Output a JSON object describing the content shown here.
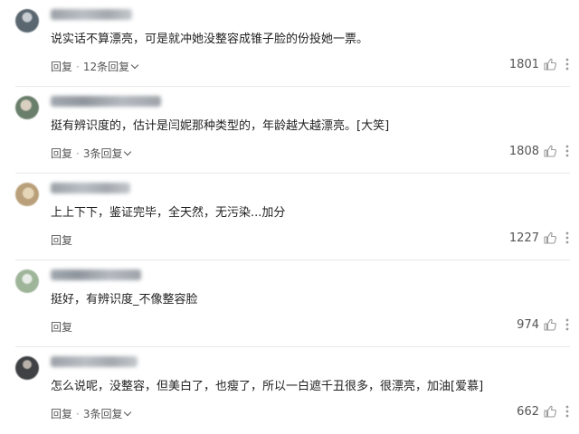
{
  "comments": [
    {
      "text": "说实话不算漂亮，可是就冲她没整容成锥子脸的份投她一票。",
      "reply_label": "回复",
      "reply_separator": "·",
      "reply_count_label": "12条回复",
      "likes": "1801",
      "avatar_color": "#5b6770"
    },
    {
      "text": "挺有辨识度的，估计是闫妮那种类型的，年龄越大越漂亮。[大笑]",
      "reply_label": "回复",
      "reply_separator": "·",
      "reply_count_label": "3条回复",
      "likes": "1808",
      "avatar_color": "#6a7f6b"
    },
    {
      "text": "上上下下，鉴证完毕，全天然，无污染...加分",
      "reply_label": "回复",
      "reply_separator": "",
      "reply_count_label": "",
      "likes": "1227",
      "avatar_color": "#b9a07a"
    },
    {
      "text": "挺好，有辨识度_不像整容脸",
      "reply_label": "回复",
      "reply_separator": "",
      "reply_count_label": "",
      "likes": "974",
      "avatar_color": "#9fb59a"
    },
    {
      "text": "怎么说呢，没整容，但美白了，也瘦了，所以一白遮千丑很多，很漂亮，加油[爱慕]",
      "reply_label": "回复",
      "reply_separator": "·",
      "reply_count_label": "3条回复",
      "likes": "662",
      "avatar_color": "#3f4144"
    }
  ],
  "icons": {
    "like": "thumbs-up-icon",
    "more": "more-vertical-icon",
    "expand": "chevron-down-icon"
  }
}
